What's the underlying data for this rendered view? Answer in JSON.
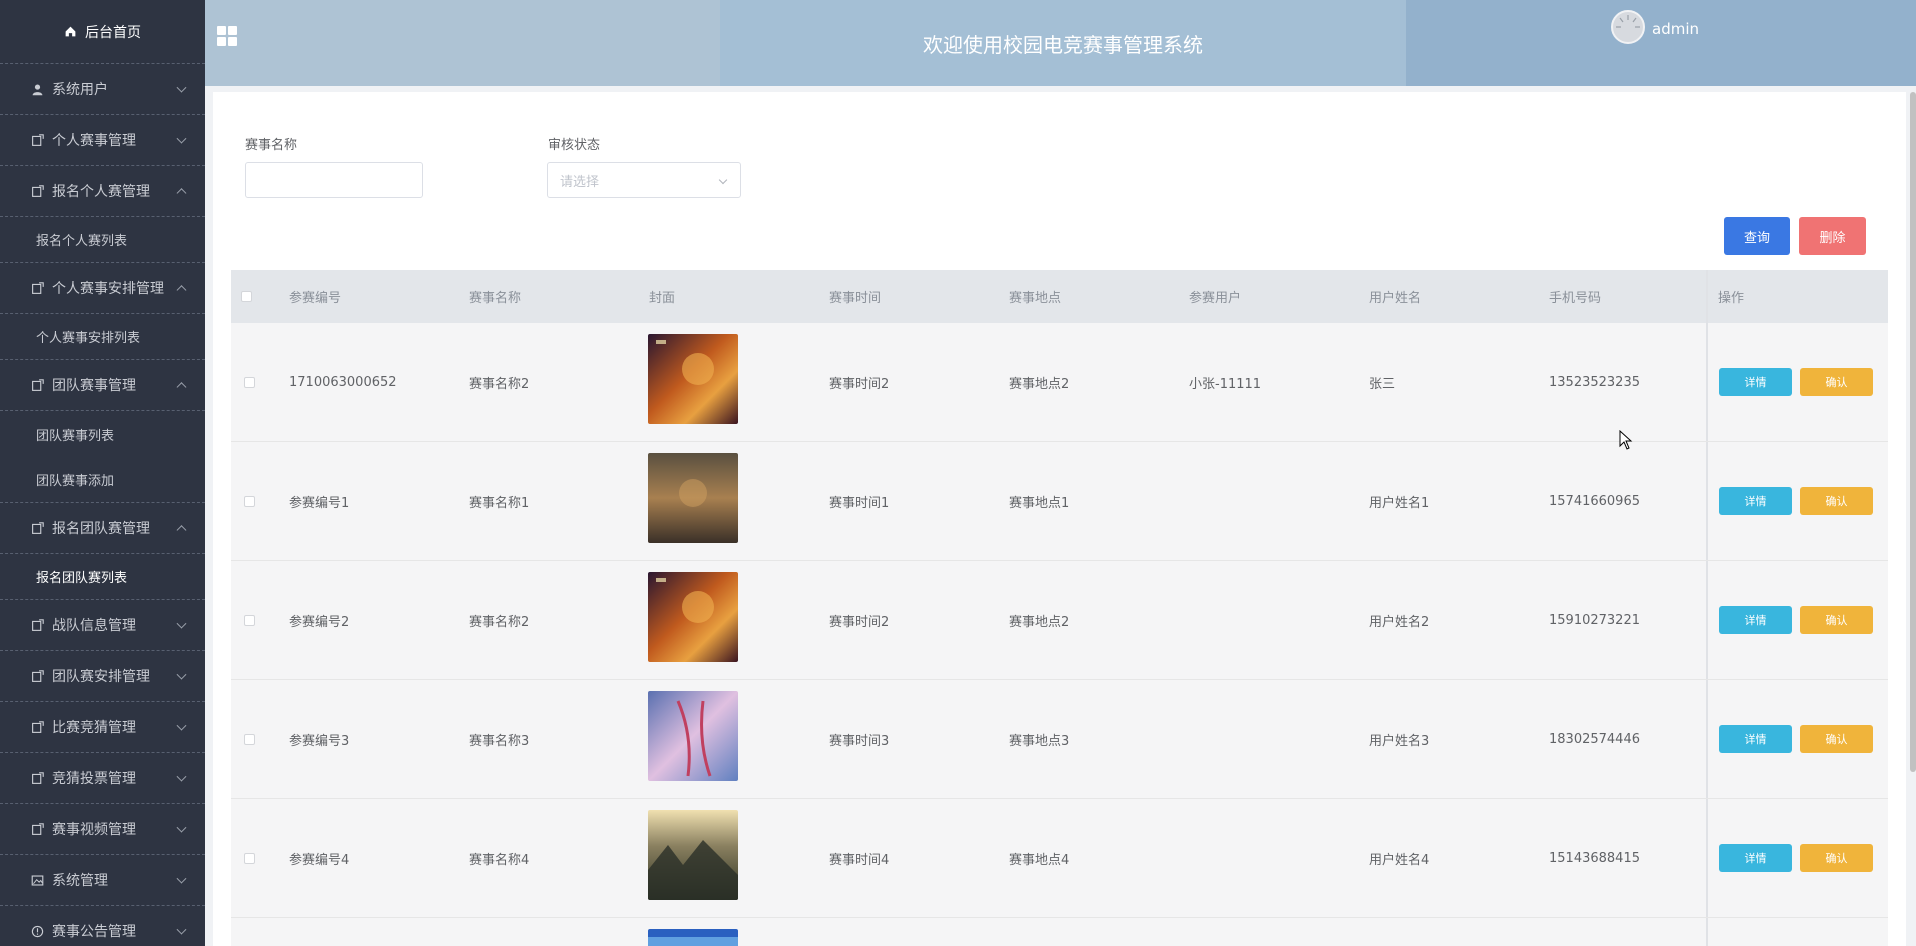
{
  "sidebar": {
    "home_label": "后台首页",
    "groups": [
      {
        "label": "系统用户",
        "icon": "user-icon",
        "expanded": false
      },
      {
        "label": "个人赛事管理",
        "icon": "doc-icon",
        "expanded": false
      },
      {
        "label": "报名个人赛管理",
        "icon": "doc-icon",
        "expanded": true,
        "sub": [
          "报名个人赛列表"
        ]
      },
      {
        "label": "个人赛事安排管理",
        "icon": "doc-icon",
        "expanded": true,
        "sub": [
          "个人赛事安排列表"
        ]
      },
      {
        "label": "团队赛事管理",
        "icon": "doc-icon",
        "expanded": true,
        "sub": [
          "团队赛事列表",
          "团队赛事添加"
        ]
      },
      {
        "label": "报名团队赛管理",
        "icon": "doc-icon",
        "expanded": true,
        "sub": [
          "报名团队赛列表"
        ]
      },
      {
        "label": "战队信息管理",
        "icon": "doc-icon",
        "expanded": false
      },
      {
        "label": "团队赛安排管理",
        "icon": "doc-icon",
        "expanded": false
      },
      {
        "label": "比赛竞猜管理",
        "icon": "doc-icon",
        "expanded": false
      },
      {
        "label": "竞猜投票管理",
        "icon": "doc-icon",
        "expanded": false
      },
      {
        "label": "赛事视频管理",
        "icon": "doc-icon",
        "expanded": false
      },
      {
        "label": "系统管理",
        "icon": "image-icon",
        "expanded": false
      },
      {
        "label": "赛事公告管理",
        "icon": "info-icon",
        "expanded": false
      }
    ],
    "active_sub": "报名团队赛列表"
  },
  "header": {
    "title": "欢迎使用校园电竞赛事管理系统",
    "username": "admin"
  },
  "search": {
    "name_label": "赛事名称",
    "name_value": "",
    "status_label": "审核状态",
    "status_placeholder": "请选择",
    "query_button": "查询",
    "delete_button": "删除"
  },
  "table": {
    "columns": [
      "参赛编号",
      "赛事名称",
      "封面",
      "赛事时间",
      "赛事地点",
      "参赛用户",
      "用户姓名",
      "手机号码",
      "操作"
    ],
    "detail_label": "详情",
    "confirm_label": "确认",
    "rows": [
      {
        "id": "1710063000652",
        "name": "赛事名称2",
        "cover": "cover-1",
        "time": "赛事时间2",
        "place": "赛事地点2",
        "user": "小张-11111",
        "realname": "张三",
        "phone": "13523523235"
      },
      {
        "id": "参赛编号1",
        "name": "赛事名称1",
        "cover": "cover-2",
        "time": "赛事时间1",
        "place": "赛事地点1",
        "user": "",
        "realname": "用户姓名1",
        "phone": "15741660965"
      },
      {
        "id": "参赛编号2",
        "name": "赛事名称2",
        "cover": "cover-1",
        "time": "赛事时间2",
        "place": "赛事地点2",
        "user": "",
        "realname": "用户姓名2",
        "phone": "15910273221"
      },
      {
        "id": "参赛编号3",
        "name": "赛事名称3",
        "cover": "cover-3",
        "time": "赛事时间3",
        "place": "赛事地点3",
        "user": "",
        "realname": "用户姓名3",
        "phone": "18302574446"
      },
      {
        "id": "参赛编号4",
        "name": "赛事名称4",
        "cover": "cover-4",
        "time": "赛事时间4",
        "place": "赛事地点4",
        "user": "",
        "realname": "用户姓名4",
        "phone": "15143688415"
      }
    ]
  }
}
